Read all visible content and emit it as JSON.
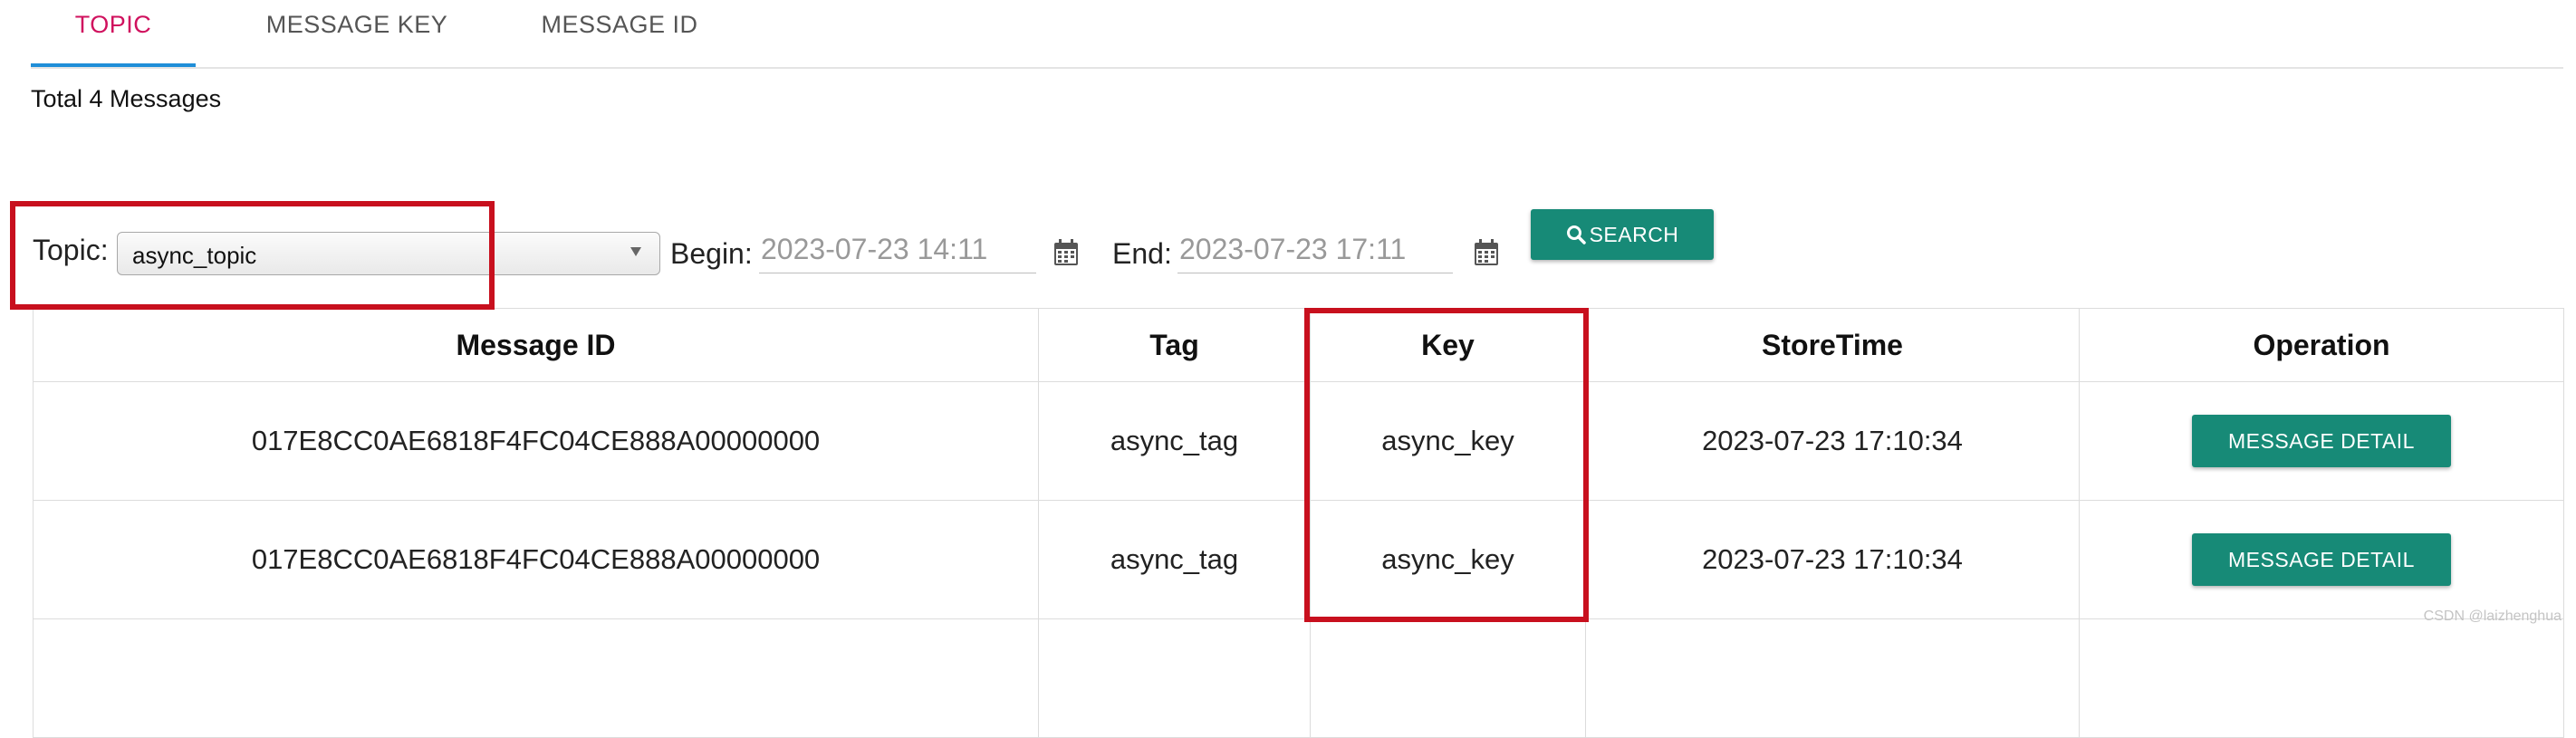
{
  "tabs": [
    {
      "label": "TOPIC",
      "active": true
    },
    {
      "label": "MESSAGE KEY",
      "active": false
    },
    {
      "label": "MESSAGE ID",
      "active": false
    }
  ],
  "summary": {
    "total_text": "Total 4 Messages"
  },
  "filters": {
    "topic_label": "Topic:",
    "topic_value": "async_topic",
    "begin_label": "Begin:",
    "begin_value": "2023-07-23 14:11",
    "end_label": "End:",
    "end_value": "2023-07-23 17:11",
    "search_label": "SEARCH"
  },
  "table": {
    "columns": [
      "Message ID",
      "Tag",
      "Key",
      "StoreTime",
      "Operation"
    ],
    "rows": [
      {
        "message_id": "017E8CC0AE6818F4FC04CE888A00000000",
        "tag": "async_tag",
        "key": "async_key",
        "store_time": "2023-07-23 17:10:34",
        "action": "MESSAGE DETAIL"
      },
      {
        "message_id": "017E8CC0AE6818F4FC04CE888A00000000",
        "tag": "async_tag",
        "key": "async_key",
        "store_time": "2023-07-23 17:10:34",
        "action": "MESSAGE DETAIL"
      }
    ]
  },
  "watermark": "CSDN @laizhenghua",
  "colors": {
    "accent": "#178a77",
    "active_tab": "#d0115e",
    "tab_indicator": "#1f8ed8",
    "highlight": "#c8101e"
  },
  "icons": [
    "search-icon",
    "calendar-icon",
    "dropdown-caret-icon"
  ]
}
